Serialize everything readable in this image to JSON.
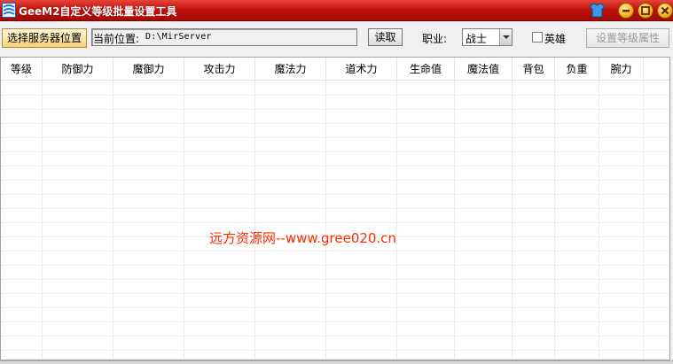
{
  "window": {
    "title": "GeeM2自定义等级批量设置工具"
  },
  "toolbar": {
    "select_server_label": "选择服务器位置",
    "path_label": "当前位置:",
    "path_value": "D:\\MirServer",
    "read_label": "读取",
    "job_label": "职业:",
    "job_value": "战士",
    "hero_label": "英雄",
    "hero_checked": false,
    "set_attr_label": "设置等级属性"
  },
  "table": {
    "columns": [
      "等级",
      "防御力",
      "魔御力",
      "攻击力",
      "魔法力",
      "道术力",
      "生命值",
      "魔法值",
      "背包",
      "负重",
      "腕力"
    ],
    "rows": []
  },
  "watermark": "远方资源网--www.gree020.cn",
  "colors": {
    "titlebar": "#c1120d",
    "watermark": "#ff2a00"
  }
}
